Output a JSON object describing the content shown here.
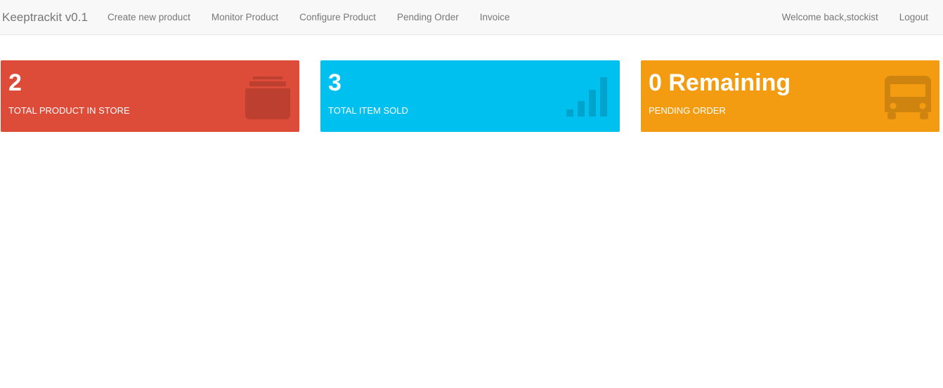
{
  "navbar": {
    "brand": "Keeptrackit v0.1",
    "links": [
      {
        "label": "Create new product"
      },
      {
        "label": "Monitor Product"
      },
      {
        "label": "Configure Product"
      },
      {
        "label": "Pending Order"
      },
      {
        "label": "Invoice"
      }
    ],
    "welcome": "Welcome back,stockist",
    "logout": "Logout"
  },
  "cards": [
    {
      "value": "2",
      "label": "TOTAL PRODUCT IN STORE",
      "color": "#dd4b39",
      "icon": "archive-icon"
    },
    {
      "value": "3",
      "label": "TOTAL ITEM SOLD",
      "color": "#00c0ef",
      "icon": "signal-bars-icon"
    },
    {
      "value": "0 Remaining",
      "label": "PENDING ORDER",
      "color": "#f39c12",
      "icon": "bus-icon"
    }
  ],
  "colors": {
    "navbar_bg": "#f8f8f8",
    "nav_text": "#777777"
  }
}
